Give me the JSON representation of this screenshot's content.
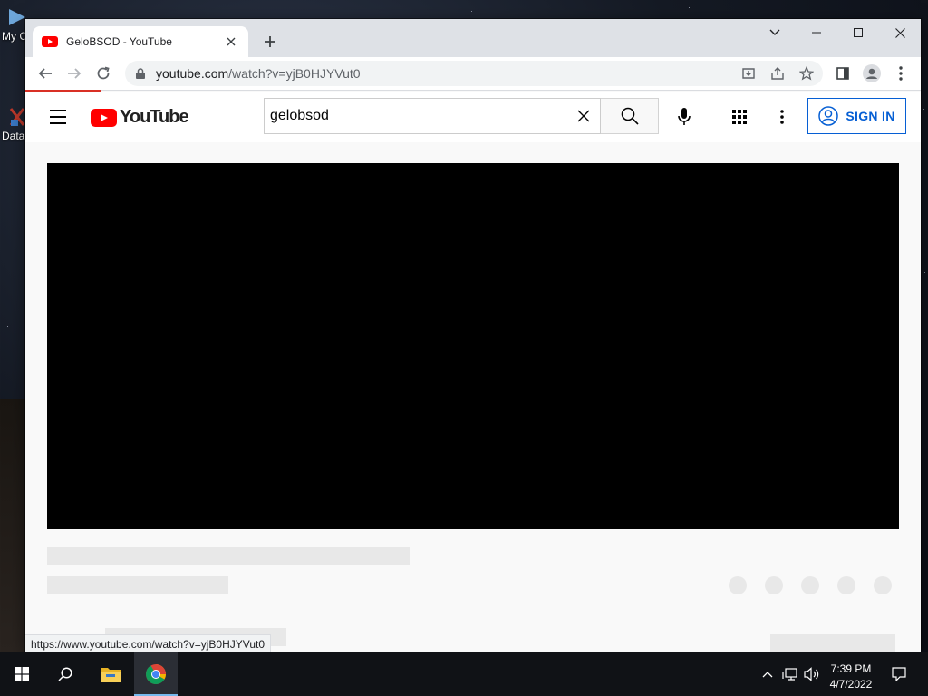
{
  "desktop": {
    "icons": [
      {
        "label": "My C"
      },
      {
        "label": "Data"
      }
    ]
  },
  "browser": {
    "tab_title": "GeloBSOD - YouTube",
    "url_domain": "youtube.com",
    "url_path": "/watch?v=yjB0HJYVut0",
    "status_url": "https://www.youtube.com/watch?v=yjB0HJYVut0"
  },
  "youtube": {
    "logo_text": "YouTube",
    "search_query": "gelobsod",
    "sign_in_label": "SIGN IN"
  },
  "taskbar": {
    "time": "7:39 PM",
    "date": "4/7/2022"
  },
  "colors": {
    "youtube_red": "#ff0000",
    "link_blue": "#065fd4",
    "loading_bar": "#d93025",
    "taskbar": "#101216"
  }
}
